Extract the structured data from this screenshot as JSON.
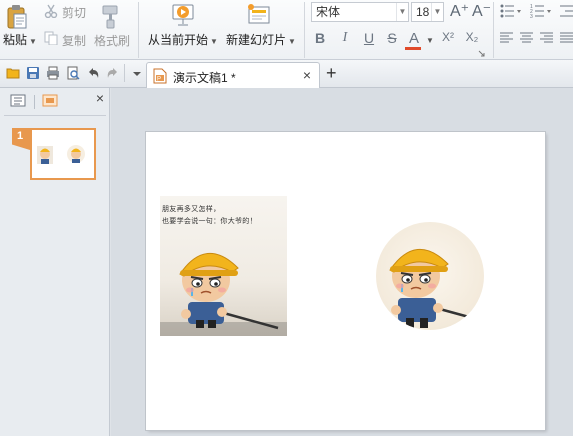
{
  "ribbon": {
    "paste_label": "粘贴",
    "cut_label": "剪切",
    "copy_label": "复制",
    "format_painter_label": "格式刷",
    "from_current_label": "从当前开始",
    "new_slide_label": "新建幻灯片",
    "font_name": "宋体",
    "font_size": "18",
    "bold_label": "B",
    "italic_label": "I",
    "underline_label": "U",
    "strike_label": "S",
    "font_color_label": "A",
    "superscript_label": "X²",
    "subscript_label": "X₂",
    "grow_font_label": "A⁺",
    "shrink_font_label": "A⁻"
  },
  "document": {
    "tab_title": "演示文稿1 *",
    "close_symbol": "×",
    "new_tab_symbol": "+"
  },
  "left_panel": {
    "close_symbol": "×",
    "slide_number": "1"
  },
  "slide": {
    "caption_line1": "朋友再多又怎样，",
    "caption_line2": "也要学会说一句：你大爷的！"
  },
  "colors": {
    "accent_orange": "#e8984e",
    "font_color_bar": "#e04a2a",
    "helmet": "#f2b41c"
  }
}
